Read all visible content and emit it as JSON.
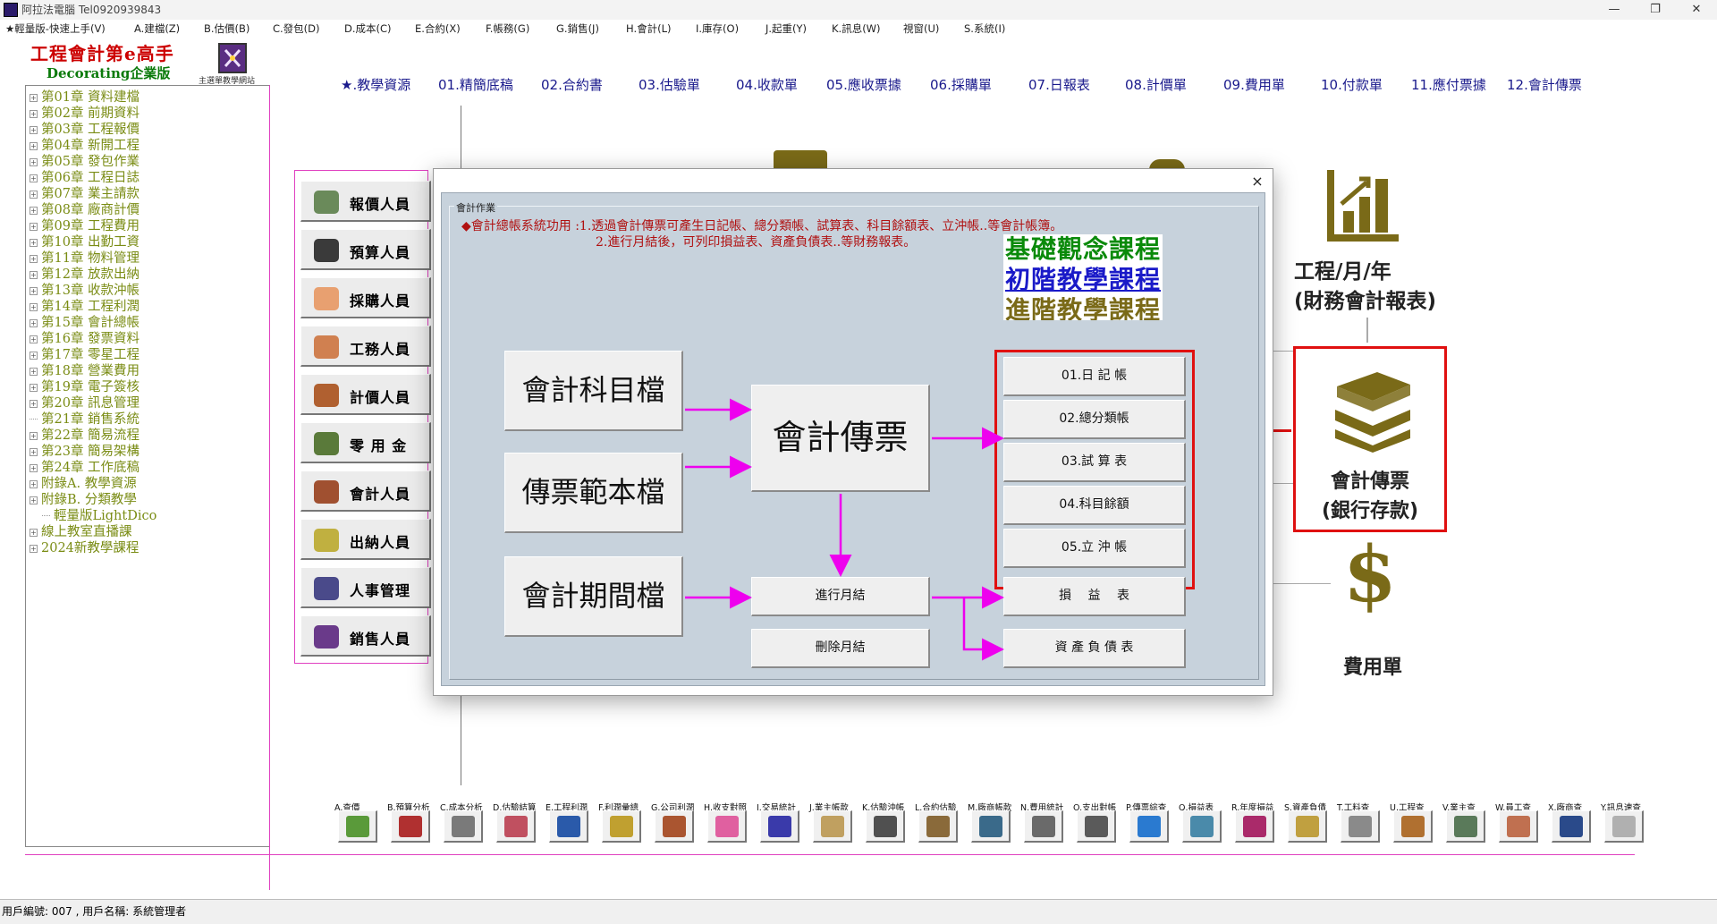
{
  "window": {
    "title": "阿拉法電腦 Tel0920939843"
  },
  "menu": [
    "★輕量版-快速上手(V)",
    "A.建檔(Z)",
    "B.估價(B)",
    "C.發包(D)",
    "D.成本(C)",
    "E.合約(X)",
    "F.帳務(G)",
    "G.銷售(J)",
    "H.會計(L)",
    "I.庫存(O)",
    "J.起重(Y)",
    "K.訊息(W)",
    "視窗(U)",
    "S.系統(I)"
  ],
  "brand": {
    "title": "工程會計第e高手",
    "subtitle": "Decorating企業版",
    "logo_caption": "主選單教學網站"
  },
  "tree": [
    "第01章 資料建檔",
    "第02章 前期資料",
    "第03章 工程報價",
    "第04章 新開工程",
    "第05章 發包作業",
    "第06章 工程日誌",
    "第07章 業主請款",
    "第08章 廠商計價",
    "第09章 工程費用",
    "第10章 出勤工資",
    "第11章 物料管理",
    "第12章 放款出納",
    "第13章 收款沖帳",
    "第14章 工程利潤",
    "第15章 會計總帳",
    "第16章 發票資料",
    "第17章 零星工程",
    "第18章 營業費用",
    "第19章 電子簽核",
    "第20章 訊息管理",
    "第21章 銷售系統",
    "第22章 簡易流程",
    "第23章 簡易架構",
    "第24章 工作底稿",
    "附錄A. 教學資源",
    "附錄B. 分類教學",
    "輕量版LightDico",
    "線上教室直播課",
    "2024新教學課程"
  ],
  "top_nav": [
    "★.教學資源",
    "01.精簡底稿",
    "02.合約書",
    "03.估驗單",
    "04.收款單",
    "05.應收票據",
    "06.採購單",
    "07.日報表",
    "08.計價單",
    "09.費用單",
    "10.付款單",
    "11.應付票據",
    "12.會計傳票"
  ],
  "roles": [
    "報價人員",
    "預算人員",
    "採購人員",
    "工務人員",
    "計價人員",
    "零 用 金",
    "會計人員",
    "出納人員",
    "人事管理",
    "銷售人員"
  ],
  "dashboard": {
    "report_line1": "工程/月/年",
    "report_line2": "(財務會計報表)",
    "voucher_line1": "會計傳票",
    "voucher_line2": "(銀行存款)",
    "expense": "費用單",
    "dollar": "$"
  },
  "dialog": {
    "close": "×",
    "group_label": "會計作業",
    "desc1": "◆會計總帳系統功用 :1.透過會計傳票可產生日記帳、總分類帳、試算表、科目餘額表、立沖帳..等會計帳簿。",
    "desc2": "2.進行月結後，可列印損益表、資產負債表..等財務報表。",
    "courses": [
      "基礎觀念課程",
      "初階教學課程",
      "進階教學課程"
    ],
    "files": [
      "會計科目檔",
      "傳票範本檔",
      "會計期間檔"
    ],
    "voucher": "會計傳票",
    "ledgers": [
      "01.日 記 帳",
      "02.總分類帳",
      "03.試 算 表",
      "04.科目餘額",
      "05.立 沖 帳"
    ],
    "month_close": "進行月結",
    "delete_close": "刪除月結",
    "income": "損　 益　 表",
    "balance": "資 產 負 債 表"
  },
  "toolbar": [
    "A.查價",
    "B.預算分析",
    "C.成本分析",
    "D.估驗結算",
    "E.工程利潤",
    "F.利潤彙總",
    "G.公司利潤",
    "H.收支對照",
    "I.交易統計",
    "J.業主帳款",
    "K.估驗沖帳",
    "L.合約估驗",
    "M.廠商帳款",
    "N.費用統計",
    "O.支出對帳",
    "P.傳票綜查",
    "Q.損益表",
    "R.年度損益",
    "S.資產負債",
    "T.工料查",
    "U.工程查",
    "V.業主查",
    "W.員工查",
    "X.廠商查",
    "Y.訊息速查"
  ],
  "status": "用戶編號: 007 , 用戶名稱: 系統管理者",
  "colors": {
    "accent_pink": "#e040c0",
    "red": "#e01010",
    "tree_olive": "#7a8c14",
    "dialog_bg": "#c7d2dc",
    "icon_olive": "#7a6a18"
  }
}
